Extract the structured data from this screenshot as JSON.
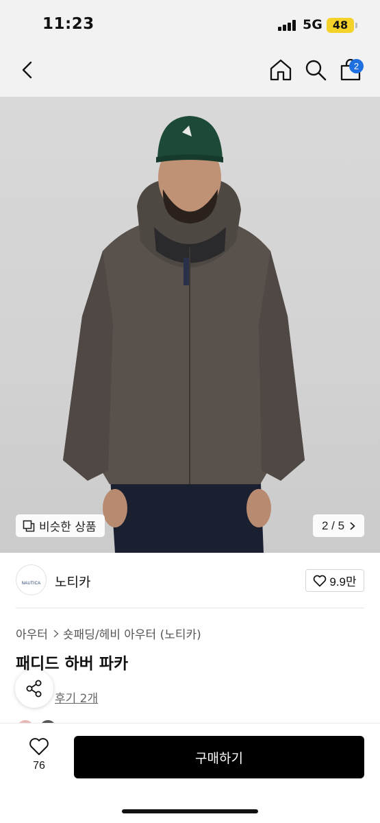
{
  "status_bar": {
    "time": "11:23",
    "network": "5G",
    "battery": "48"
  },
  "nav": {
    "cart_count": "2"
  },
  "hero": {
    "similar_label": "비슷한 상품",
    "counter": "2 / 5"
  },
  "brand": {
    "logo_text": "NAUTICA",
    "name": "노티카",
    "likes": "9.9만"
  },
  "breadcrumb": {
    "level1": "아우터",
    "level2": "숏패딩/헤비 아우터 (노티카)"
  },
  "product": {
    "title": "패디드 하버 파카",
    "review_link": "후기 2개"
  },
  "bottom": {
    "wish_count": "76",
    "buy_label": "구매하기"
  },
  "colors": {
    "accent": "#1e6fe0",
    "battery": "#f5d229",
    "buy_button": "#000000"
  }
}
